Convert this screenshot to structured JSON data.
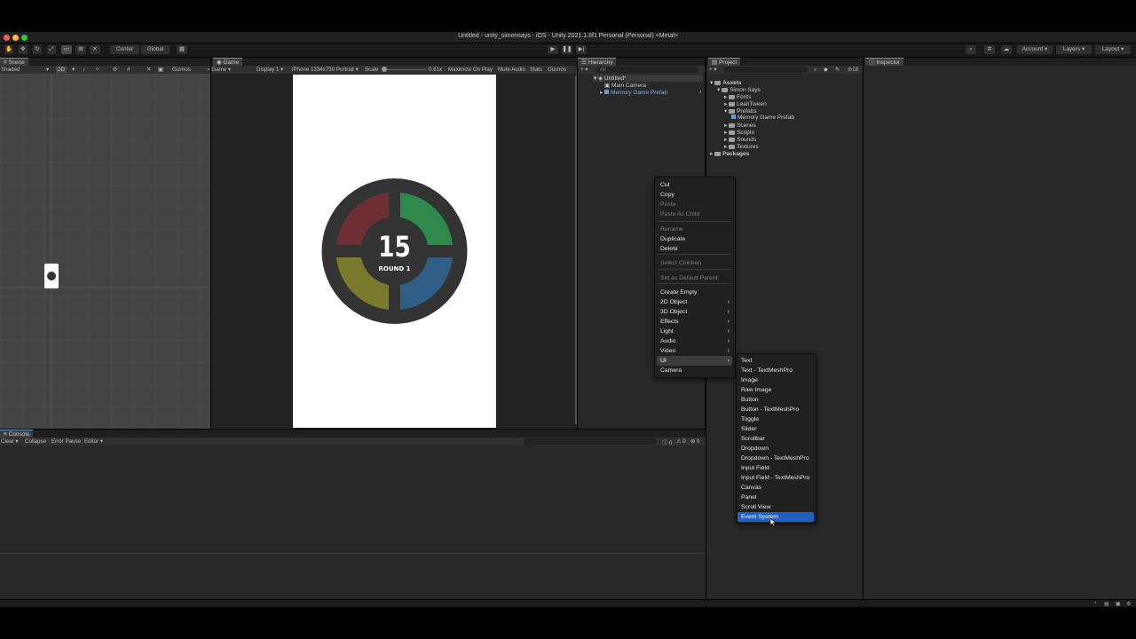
{
  "window": {
    "title": "Untitled - unity_simonsays - iOS - Unity 2021.1.6f1 Personal (Personal) <Metal>"
  },
  "toolbar": {
    "center_label": "Center",
    "global_label": "Global",
    "account_label": "Account",
    "layers_label": "Layers",
    "layout_label": "Layout"
  },
  "scene": {
    "tab": "Scene",
    "shading": "Shaded",
    "mode_2d": "2D",
    "gizmos": "Gizmos"
  },
  "game": {
    "tab": "Game",
    "game_dropdown": "Game",
    "display": "Display 1",
    "resolution": "iPhone 1334x750 Portrait",
    "scale_label": "Scale",
    "scale_value": "0.61x",
    "maximize": "Maximize On Play",
    "mute": "Mute Audio",
    "stats": "Stats",
    "gizmos": "Gizmos",
    "counter": "15",
    "round": "ROUND 1",
    "colors": {
      "red": "#6e2f34",
      "green": "#2e8a4c",
      "yellow": "#7a7a2c",
      "blue": "#2f5f86",
      "ring": "#333333"
    }
  },
  "hierarchy": {
    "tab": "Hierarchy",
    "search": "All",
    "items": [
      "Untitled*",
      "Main Camera",
      "Memory Game Prefab"
    ]
  },
  "project": {
    "tab": "Project",
    "badge": "18",
    "tree": [
      {
        "label": "Assets",
        "indent": 0
      },
      {
        "label": "Simon Says",
        "indent": 1
      },
      {
        "label": "Fonts",
        "indent": 2
      },
      {
        "label": "LeanTween",
        "indent": 2
      },
      {
        "label": "Prefabs",
        "indent": 2
      },
      {
        "label": "Memory Game Prefab",
        "indent": 3
      },
      {
        "label": "Scenes",
        "indent": 2
      },
      {
        "label": "Scripts",
        "indent": 2
      },
      {
        "label": "Sounds",
        "indent": 2
      },
      {
        "label": "Textures",
        "indent": 2
      },
      {
        "label": "Packages",
        "indent": 0
      }
    ]
  },
  "inspector": {
    "tab": "Inspector"
  },
  "console": {
    "tab": "Console",
    "clear": "Clear",
    "collapse": "Collapse",
    "error_pause": "Error Pause",
    "editor": "Editor",
    "count_log": "0",
    "count_warn": "0",
    "count_err": "0"
  },
  "context_menu": [
    {
      "label": "Cut",
      "enabled": true
    },
    {
      "label": "Copy",
      "enabled": true
    },
    {
      "label": "Paste",
      "enabled": false
    },
    {
      "label": "Paste As Child",
      "enabled": false
    },
    {
      "label": "Rename",
      "enabled": false
    },
    {
      "label": "Duplicate",
      "enabled": true
    },
    {
      "label": "Delete",
      "enabled": true
    },
    {
      "label": "Select Children",
      "enabled": false
    },
    {
      "label": "Set as Default Parent",
      "enabled": false
    },
    {
      "label": "Create Empty",
      "enabled": true
    },
    {
      "label": "2D Object",
      "enabled": true,
      "submenu": true
    },
    {
      "label": "3D Object",
      "enabled": true,
      "submenu": true
    },
    {
      "label": "Effects",
      "enabled": true,
      "submenu": true
    },
    {
      "label": "Light",
      "enabled": true,
      "submenu": true
    },
    {
      "label": "Audio",
      "enabled": true,
      "submenu": true
    },
    {
      "label": "Video",
      "enabled": true,
      "submenu": true
    },
    {
      "label": "UI",
      "enabled": true,
      "submenu": true,
      "active": true
    },
    {
      "label": "Camera",
      "enabled": true
    }
  ],
  "ui_submenu": [
    "Text",
    "Text - TextMeshPro",
    "Image",
    "Raw Image",
    "Button",
    "Button - TextMeshPro",
    "Toggle",
    "Slider",
    "Scrollbar",
    "Dropdown",
    "Dropdown - TextMeshPro",
    "Input Field",
    "Input Field - TextMeshPro",
    "Canvas",
    "Panel",
    "Scroll View",
    "Event System"
  ],
  "ui_submenu_selected": "Event System"
}
